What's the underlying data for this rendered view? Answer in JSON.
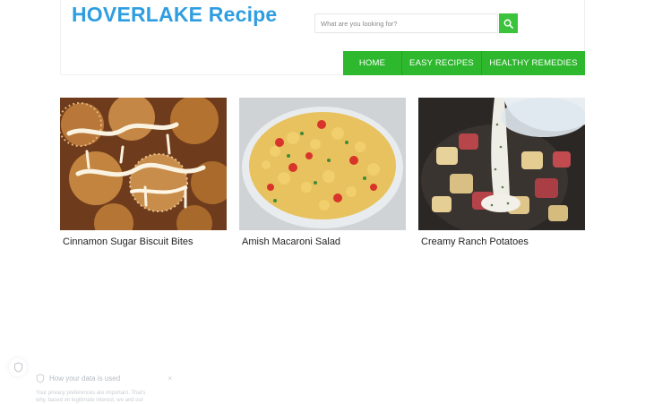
{
  "site": {
    "title": "HOVERLAKE Recipe"
  },
  "search": {
    "placeholder": "What are you looking for?",
    "icon": "search-icon"
  },
  "nav": {
    "items": [
      {
        "label": "HOME"
      },
      {
        "label": "EASY RECIPES"
      },
      {
        "label": "HEALTHY REMEDIES"
      }
    ]
  },
  "cards": [
    {
      "title": "Cinnamon Sugar Biscuit Bites"
    },
    {
      "title": "Amish Macaroni Salad"
    },
    {
      "title": "Creamy Ranch Potatoes"
    }
  ],
  "privacy": {
    "title": "How your data is used",
    "close": "×",
    "text": "Your privacy preferences are important. That's why, based on legitimate interest, we and our"
  },
  "colors": {
    "brand": "#2f9ee0",
    "accent_green": "#2db82d",
    "search_button": "#3cc33c"
  }
}
